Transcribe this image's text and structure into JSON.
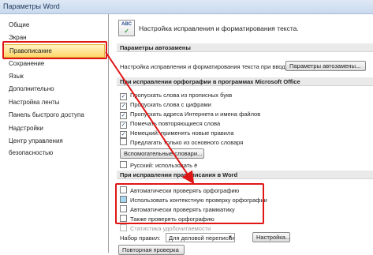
{
  "window": {
    "title": "Параметры Word"
  },
  "sidebar": {
    "items": [
      {
        "label": "Общие"
      },
      {
        "label": "Экран"
      },
      {
        "label": "Правописание"
      },
      {
        "label": "Сохранение"
      },
      {
        "label": "Язык"
      },
      {
        "label": "Дополнительно"
      },
      {
        "label": "Настройка ленты"
      },
      {
        "label": "Панель быстрого доступа"
      },
      {
        "label": "Надстройки"
      },
      {
        "label": "Центр управления безопасностью"
      }
    ]
  },
  "main": {
    "header_icon": "abc-spelling-icon",
    "header_icon_text": "ABC",
    "header_text": "Настройка исправления и форматирования текста.",
    "autocorrect": {
      "section_title": "Параметры автозамены",
      "description": "Настройка исправления и форматирования текста при вводе:",
      "button": "Параметры автозамены..."
    },
    "office_spelling": {
      "section_title": "При исправлении орфографии в программах Microsoft Office",
      "options": [
        {
          "label": "Пропускать слова из прописных букв",
          "checked": true
        },
        {
          "label": "Пропускать слова с цифрами",
          "checked": true
        },
        {
          "label": "Пропускать адреса Интернета и имена файлов",
          "checked": true
        },
        {
          "label": "Помечать повторяющиеся слова",
          "checked": true
        },
        {
          "label": "Немецкий: применять новые правила",
          "checked": true
        },
        {
          "label": "Предлагать только из основного словаря",
          "checked": false
        }
      ],
      "dictionaries_button": "Вспомогательные словари...",
      "russian_option": {
        "label": "Русский: использовать ё",
        "checked": false
      }
    },
    "word_spelling": {
      "section_title": "При исправлении правописания в Word",
      "options": [
        {
          "label": "Автоматически проверять орфографию",
          "checked": false
        },
        {
          "label": "Использовать контекстную проверку орфографии",
          "checked": false
        },
        {
          "label": "Автоматически проверять грамматику",
          "checked": false
        },
        {
          "label": "Также проверять орфографию",
          "checked": false
        }
      ],
      "readability": {
        "label": "Статистика удобочитаемости",
        "checked": false
      },
      "ruleset_label": "Набор правил:",
      "ruleset_value": "Для деловой переписки",
      "settings_button": "Настройка...",
      "recheck_button": "Повторная проверка"
    }
  },
  "colors": {
    "annotation": "#e01616",
    "selected_nav": "#ffd86a"
  }
}
